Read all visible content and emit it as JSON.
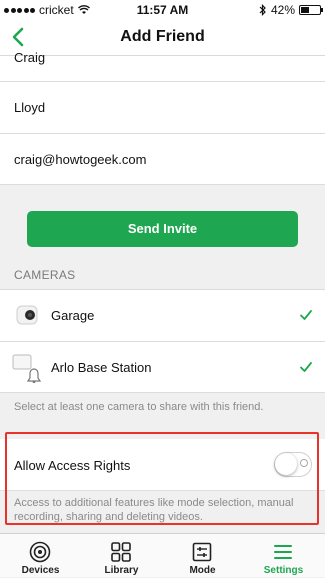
{
  "status_bar": {
    "carrier": "cricket",
    "time": "11:57 AM",
    "battery": "42%",
    "battery_level": 0.42
  },
  "nav": {
    "title": "Add Friend"
  },
  "form": {
    "first_name": "Craig",
    "last_name": "Lloyd",
    "email": "craig@howtogeek.com"
  },
  "send_invite_label": "Send Invite",
  "cameras_header": "CAMERAS",
  "cameras": [
    {
      "name": "Garage",
      "checked": true
    },
    {
      "name": "Arlo Base Station",
      "checked": true
    }
  ],
  "helper_text": "Select at least one camera to share with this friend.",
  "access": {
    "label": "Allow Access Rights",
    "enabled": false,
    "description": "Access to additional features like mode selection, manual recording, sharing and deleting videos."
  },
  "tabs": [
    {
      "label": "Devices",
      "icon": "devices-icon",
      "active": false
    },
    {
      "label": "Library",
      "icon": "library-icon",
      "active": false
    },
    {
      "label": "Mode",
      "icon": "mode-icon",
      "active": false
    },
    {
      "label": "Settings",
      "icon": "settings-icon",
      "active": true
    }
  ],
  "colors": {
    "accent": "#1fa650",
    "highlight": "#e8332a"
  }
}
